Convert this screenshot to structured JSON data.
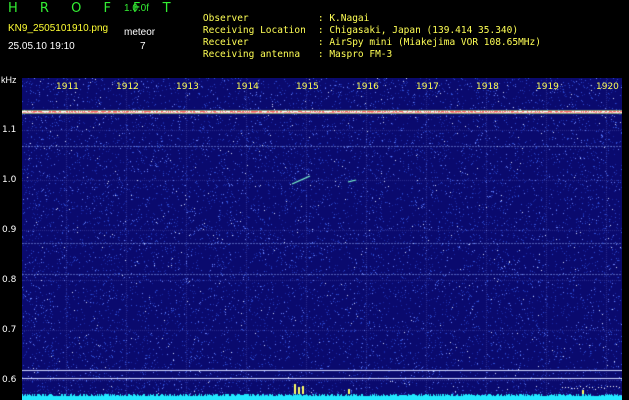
{
  "header": {
    "app_title": "H R O F F T",
    "version": "1.0.0f",
    "filename": "KN9_2505101910.png",
    "mode": "meteor",
    "datetime": "25.05.10 19:10",
    "count": "7"
  },
  "station": [
    {
      "label": "Observer",
      "value": ": K.Nagai"
    },
    {
      "label": "Receiving Location",
      "value": ": Chigasaki, Japan (139.414 35.340)"
    },
    {
      "label": "Receiver",
      "value": ": AirSpy mini (Miakejima VOR 108.65MHz)"
    },
    {
      "label": "Receiving antenna",
      "value": ": Maspro FM-3"
    }
  ],
  "axis": {
    "y_unit": "kHz",
    "x_ticks": [
      "1911",
      "1912",
      "1913",
      "1914",
      "1915",
      "1916",
      "1917",
      "1918",
      "1919",
      "1920"
    ],
    "y_ticks": [
      "1.1",
      "1.0",
      "0.9",
      "0.8",
      "0.7",
      "0.6"
    ]
  },
  "colors": {
    "background": "#0a0a6e",
    "carrier": "#ff6666",
    "baseline": "#22e8ff",
    "label_yellow": "#ffff55",
    "title_green": "#33ee33"
  }
}
